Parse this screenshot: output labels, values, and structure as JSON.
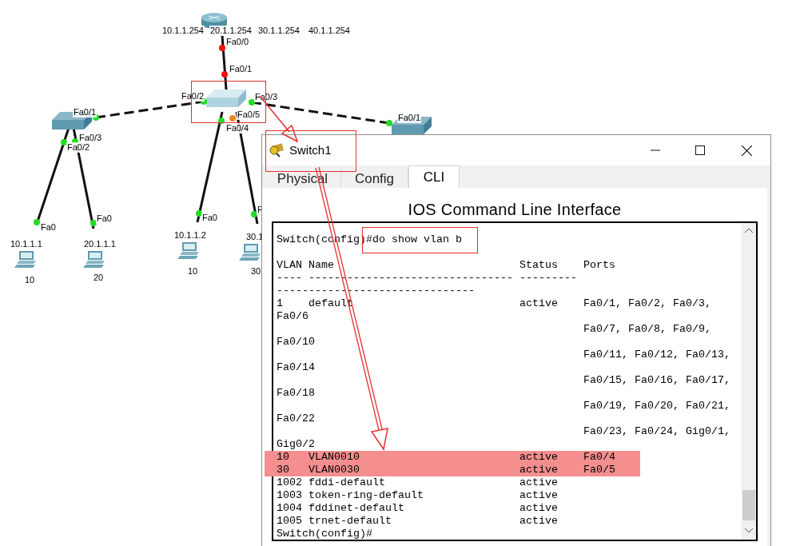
{
  "topology": {
    "router_addresses": [
      "10.1.1.254",
      "20.1.1.254",
      "30.1.1.254",
      "40.1.1.254"
    ],
    "ports": [
      {
        "label": "Fa0/0",
        "color": "#ee1111"
      },
      {
        "label": "Fa0/1",
        "color": "#ee1111"
      },
      {
        "label": "Fa0/2",
        "color": "#22dd22"
      },
      {
        "label": "Fa0/3",
        "color": "#22dd22"
      },
      {
        "label": "Fa0/1",
        "color": "#22dd22"
      },
      {
        "label": "Fa0/1",
        "color": "#22dd22"
      },
      {
        "label": "Fa0/5",
        "color": "#f08a20"
      },
      {
        "label": "Fa0/4",
        "color": "#22dd22"
      },
      {
        "label": "Fa0/3",
        "color": "#22dd22"
      },
      {
        "label": "Fa0/2",
        "color": "#22dd22"
      },
      {
        "label": "Fa0",
        "color": "#22dd22"
      },
      {
        "label": "Fa0",
        "color": "#22dd22"
      },
      {
        "label": "Fa0",
        "color": "#22dd22"
      },
      {
        "label": "F",
        "color": "#22dd22"
      }
    ],
    "hosts": [
      {
        "address": "10.1.1.1",
        "vlan": "10"
      },
      {
        "address": "20.1.1.1",
        "vlan": "20"
      },
      {
        "address": "10.1.1.2",
        "vlan": "10"
      },
      {
        "address": "30.1",
        "vlan": "30"
      }
    ]
  },
  "window": {
    "title": "Switch1",
    "tabs": [
      {
        "label": "Physical",
        "selected": false
      },
      {
        "label": "Config",
        "selected": false
      },
      {
        "label": "CLI",
        "selected": true
      }
    ],
    "heading": "IOS Command Line Interface",
    "cli_lines": [
      {
        "kind": "text",
        "text": "Switch(config)#do show vlan b"
      },
      {
        "kind": "row",
        "space_before": true,
        "vlan": "VLAN",
        "name": "Name",
        "status": "Status",
        "ports": "Ports"
      },
      {
        "kind": "row",
        "vlan": "----",
        "name": "--------------------------------",
        "status": "---------"
      },
      {
        "kind": "text",
        "text": "-------------------------------"
      },
      {
        "kind": "row",
        "vlan": "1",
        "name": "default",
        "status": "active",
        "ports": "Fa0/1, Fa0/2, Fa0/3,"
      },
      {
        "kind": "text",
        "text": "Fa0/6"
      },
      {
        "kind": "row",
        "ports": "Fa0/7, Fa0/8, Fa0/9,"
      },
      {
        "kind": "text",
        "text": "Fa0/10"
      },
      {
        "kind": "row",
        "ports": "Fa0/11, Fa0/12, Fa0/13,"
      },
      {
        "kind": "text",
        "text": "Fa0/14"
      },
      {
        "kind": "row",
        "ports": "Fa0/15, Fa0/16, Fa0/17,"
      },
      {
        "kind": "text",
        "text": "Fa0/18"
      },
      {
        "kind": "row",
        "ports": "Fa0/19, Fa0/20, Fa0/21,"
      },
      {
        "kind": "text",
        "text": "Fa0/22"
      },
      {
        "kind": "row",
        "ports": "Fa0/23, Fa0/24, Gig0/1,"
      },
      {
        "kind": "text",
        "text": "Gig0/2"
      },
      {
        "kind": "row",
        "highlighted": true,
        "vlan": "10",
        "name": "VLAN0010",
        "status": "active",
        "ports": "Fa0/4"
      },
      {
        "kind": "row",
        "highlighted": true,
        "vlan": "30",
        "name": "VLAN0030",
        "status": "active",
        "ports": "Fa0/5"
      },
      {
        "kind": "row",
        "vlan": "1002",
        "name": "fddi-default",
        "status": "active"
      },
      {
        "kind": "row",
        "vlan": "1003",
        "name": "token-ring-default",
        "status": "active"
      },
      {
        "kind": "row",
        "vlan": "1004",
        "name": "fddinet-default",
        "status": "active"
      },
      {
        "kind": "row",
        "vlan": "1005",
        "name": "trnet-default",
        "status": "active"
      },
      {
        "kind": "text",
        "text": "Switch(config)#"
      }
    ]
  }
}
